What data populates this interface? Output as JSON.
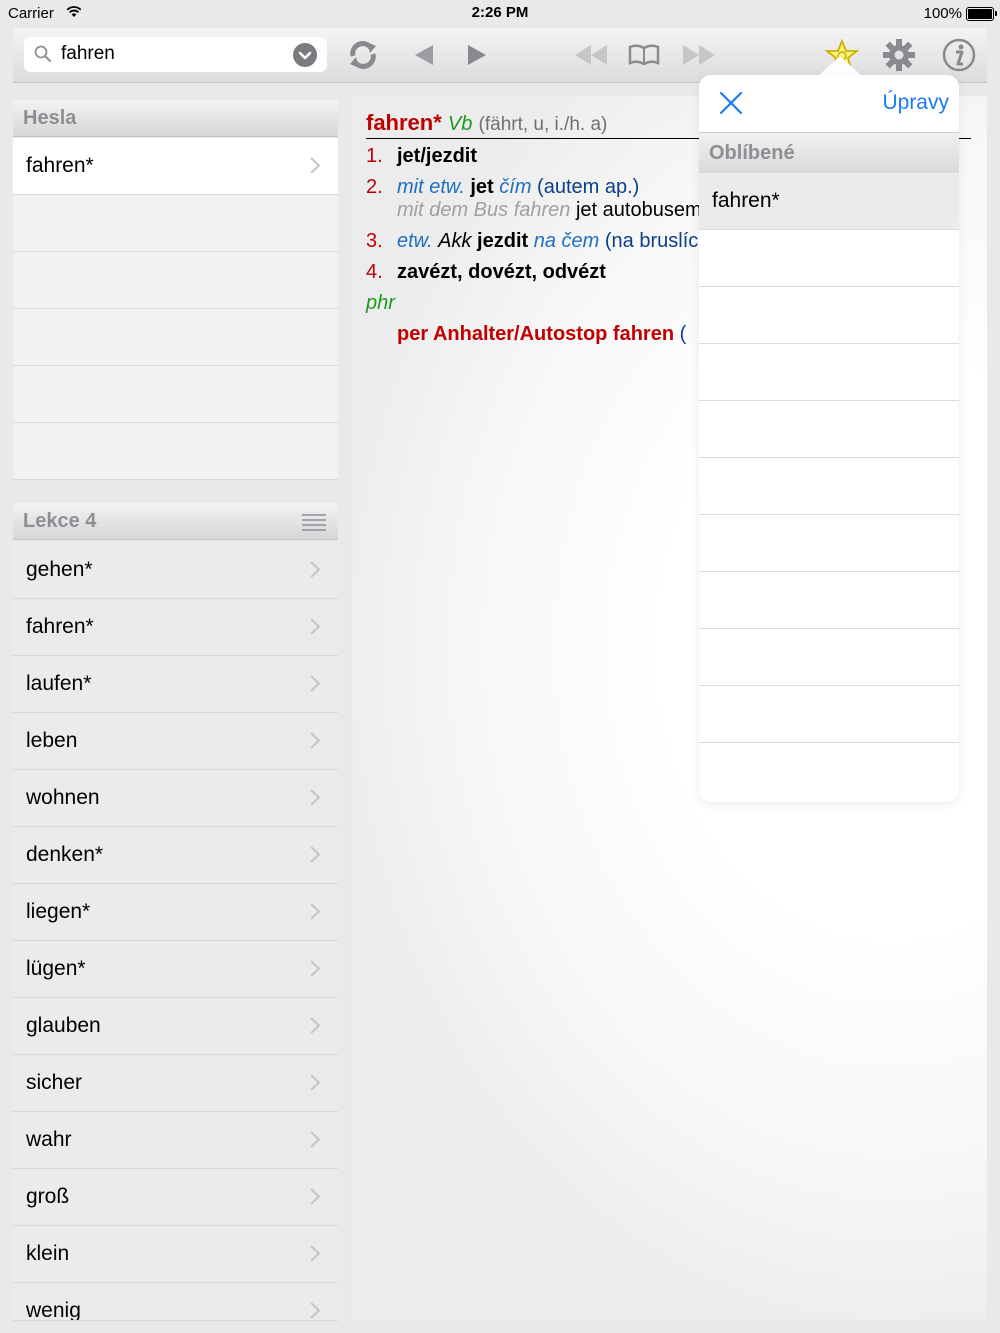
{
  "status_bar": {
    "carrier": "Carrier",
    "time": "2:26 PM",
    "battery": "100%"
  },
  "search": {
    "value": "fahren"
  },
  "hesla": {
    "title": "Hesla",
    "items": [
      "fahren*"
    ]
  },
  "lekce": {
    "title": "Lekce 4",
    "items": [
      "gehen*",
      "fahren*",
      "laufen*",
      "leben",
      "wohnen",
      "denken*",
      "liegen*",
      "lügen*",
      "glauben",
      "sicher",
      "wahr",
      "groß",
      "klein",
      "wenig"
    ]
  },
  "entry": {
    "headword": "fahren*",
    "pos": "Vb",
    "grammar": "(fährt, u, i./h. a)",
    "s1": {
      "num": "1.",
      "t": "jet/jezdit"
    },
    "s2": {
      "num": "2.",
      "a": "mit etw.",
      "b": "jet",
      "c": "čím",
      "d": "(autem ap.)",
      "ex_de": "mit dem Bus fahren",
      "ex_cs": "jet autobusem"
    },
    "s3": {
      "num": "3.",
      "a": "etw.",
      "b": "Akk",
      "c": "jezdit",
      "d": "na čem",
      "e": "(na bruslích)"
    },
    "s4": {
      "num": "4.",
      "t": "zavézt, dovézt, odvézt"
    },
    "phr_label": "phr",
    "phrase": "per Anhalter/Autostop fahren",
    "phrase_tail": "("
  },
  "popover": {
    "edit": "Úpravy",
    "section": "Oblíbené",
    "items": [
      "fahren*"
    ]
  }
}
